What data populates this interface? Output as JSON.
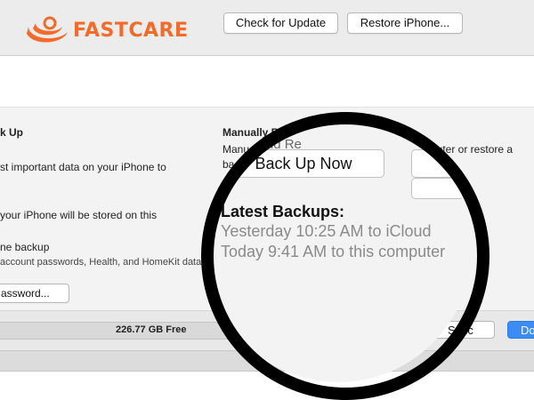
{
  "brand": {
    "name": "FASTCARE",
    "color": "#f26b2a"
  },
  "toolbar": {
    "check_update": "Check for Update",
    "restore_iphone": "Restore iPhone..."
  },
  "left": {
    "heading": "k Up",
    "line1": "st important data on your iPhone to",
    "line2": "your iPhone will be stored on this",
    "encrypt_title": "ne backup",
    "encrypt_desc": "account passwords, Health, and HomeKit data to",
    "password_button": "assword..."
  },
  "right": {
    "heading_visible": "Manually B",
    "manual_prefix": "Manu",
    "manual_prefix2": "ba",
    "desc_visible": "mputer or restore a"
  },
  "magnifier": {
    "heading_fragment": "ck Up and Re",
    "back_up_now": "Back Up Now",
    "latest_backups_title": "Latest Backups:",
    "backups": [
      "Yesterday 10:25 AM to iCloud",
      "Today 9:41 AM to this computer"
    ]
  },
  "storage": {
    "free_label": "226.77 GB Free"
  },
  "footer": {
    "sync": "Sync",
    "done": "Do"
  },
  "colors": {
    "accent": "#3b8df5",
    "panel": "#f3f3f3"
  }
}
